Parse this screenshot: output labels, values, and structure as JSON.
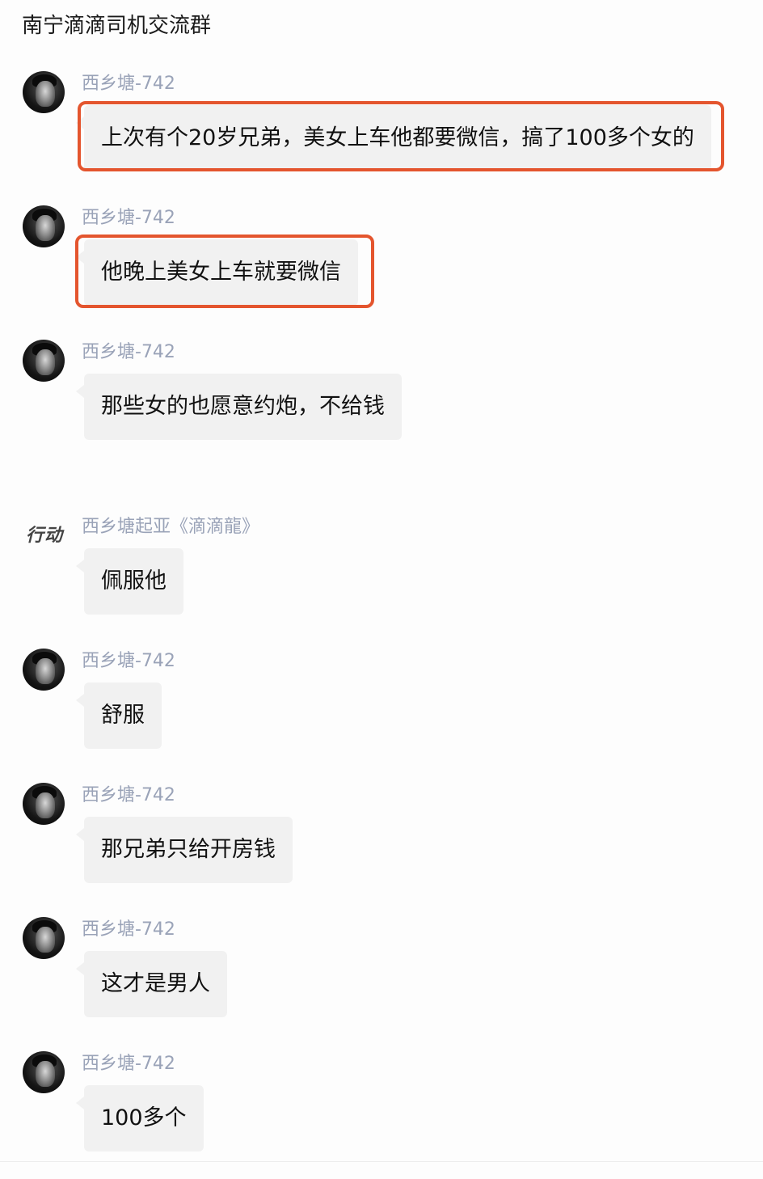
{
  "header": {
    "title": "南宁滴滴司机交流群"
  },
  "messages": [
    {
      "sender": "西乡塘-742",
      "text": "上次有个20岁兄弟，美女上车他都要微信，搞了100多个女的",
      "highlighted": true
    },
    {
      "sender": "西乡塘-742",
      "text": "他晚上美女上车就要微信",
      "highlighted": true
    },
    {
      "sender": "西乡塘-742",
      "text": "那些女的也愿意约炮，不给钱",
      "highlighted": false
    },
    {
      "sender": "西乡塘起亚《滴滴龍》",
      "avatar_text": "行动",
      "text": "佩服他",
      "highlighted": false
    },
    {
      "sender": "西乡塘-742",
      "text": "舒服",
      "highlighted": false
    },
    {
      "sender": "西乡塘-742",
      "text": "那兄弟只给开房钱",
      "highlighted": false
    },
    {
      "sender": "西乡塘-742",
      "text": "这才是男人",
      "highlighted": false
    },
    {
      "sender": "西乡塘-742",
      "text": "100多个",
      "highlighted": false
    }
  ],
  "colors": {
    "highlight": "#e4552e",
    "sender": "#9aa3b8",
    "bubble": "#f1f1f1"
  }
}
